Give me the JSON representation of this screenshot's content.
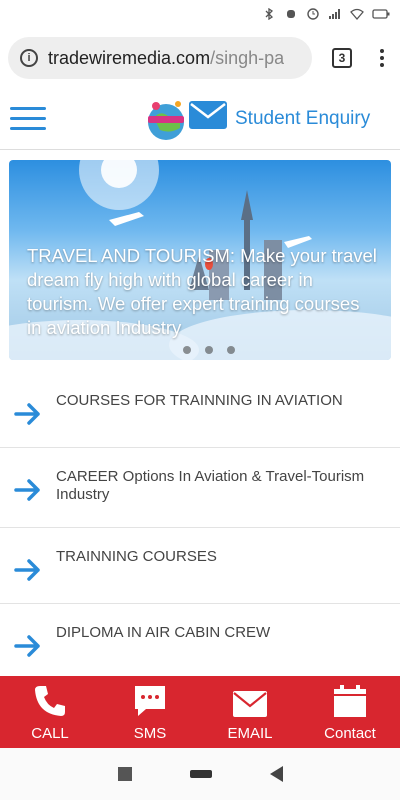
{
  "statusbar": {
    "icons": [
      "bluetooth-icon",
      "vibrate-icon",
      "alarm-icon",
      "signal-icon",
      "wifi-icon",
      "battery-icon"
    ]
  },
  "browser": {
    "url_domain": "tradewiremedia.com",
    "url_path": "/singh-pa",
    "tab_count": "3"
  },
  "header": {
    "enquiry_label": "Student Enquiry",
    "accent": "#2a8bd8"
  },
  "banner": {
    "text": "TRAVEL AND TOURISM: Make your travel dream fly high with global career in tourism. We offer expert training courses in aviation Industry"
  },
  "menu": {
    "items": [
      {
        "label": "COURSES FOR TRAINNING IN AVIATION"
      },
      {
        "label": "CAREER Options In Aviation & Travel-Tourism Industry"
      },
      {
        "label": "TRAINNING COURSES"
      },
      {
        "label": "DIPLOMA IN AIR CABIN CREW"
      }
    ]
  },
  "bottomnav": {
    "color": "#d8262f",
    "items": [
      {
        "label": "CALL",
        "icon": "phone-icon"
      },
      {
        "label": "SMS",
        "icon": "sms-icon"
      },
      {
        "label": "EMAIL",
        "icon": "email-icon"
      },
      {
        "label": "Contact",
        "icon": "calendar-icon"
      }
    ]
  }
}
